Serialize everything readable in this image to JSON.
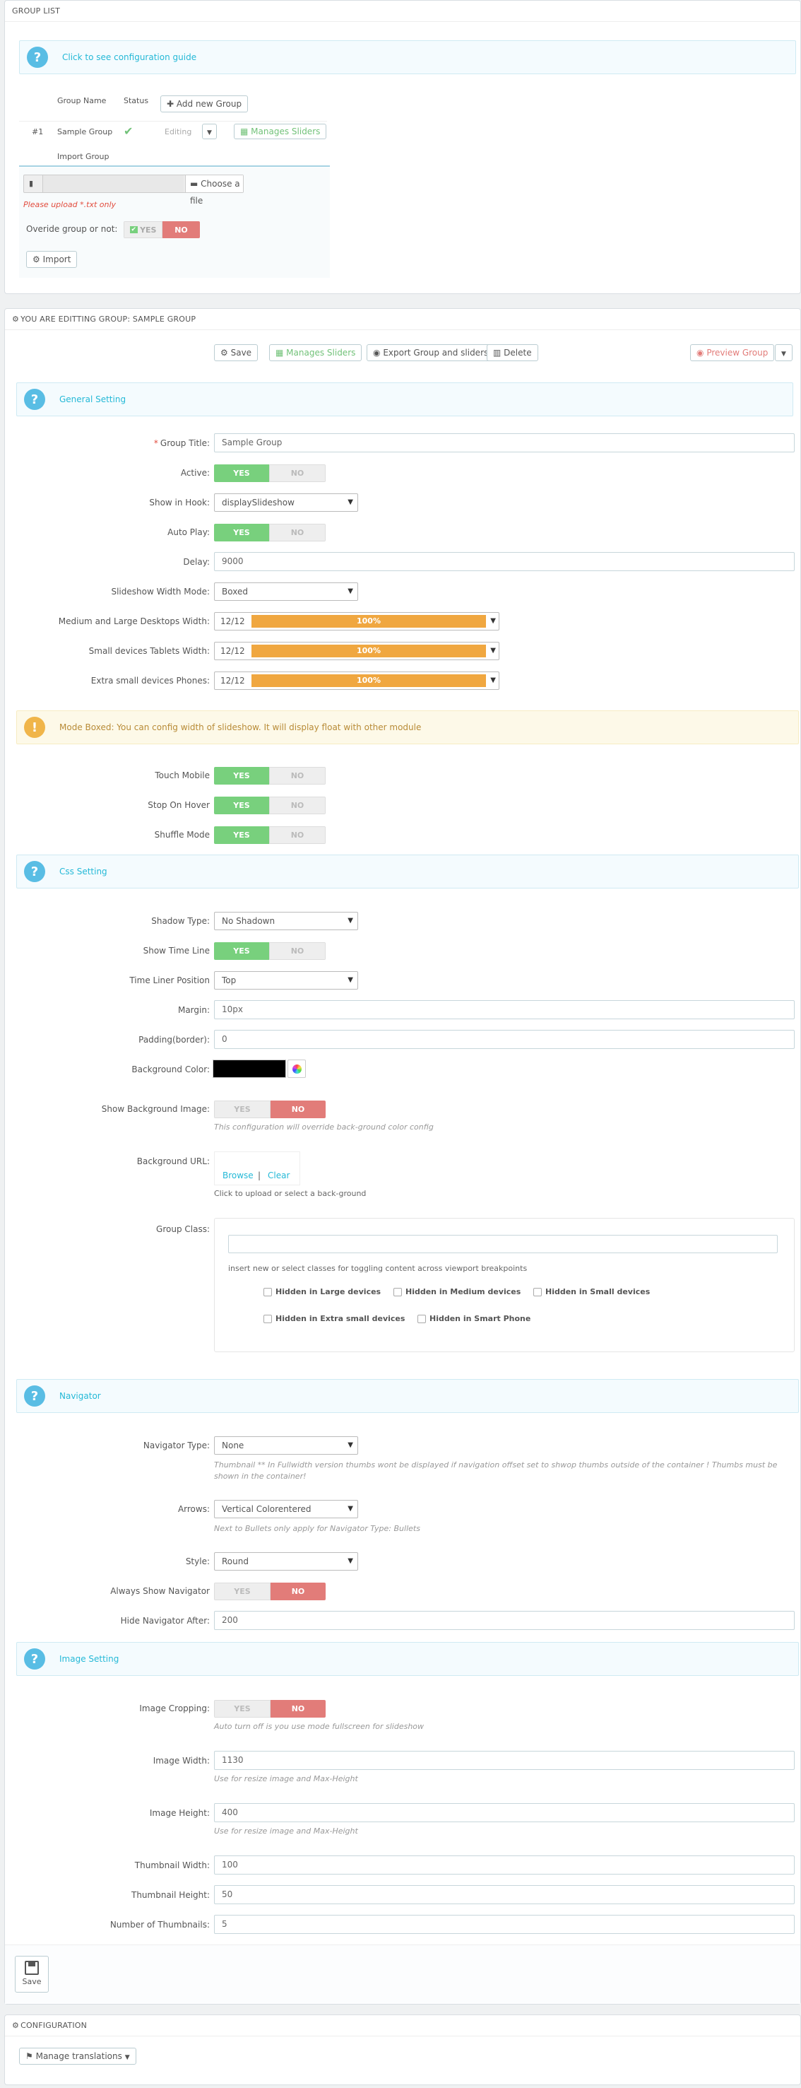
{
  "group_list": {
    "heading": "GROUP LIST",
    "guide": "Click to see configuration guide",
    "col_name": "Group Name",
    "col_status": "Status",
    "add_new": "Add new Group",
    "row": {
      "num": "#1",
      "name": "Sample Group",
      "editing": "Editing",
      "manage": "Manages Sliders"
    },
    "import_title": "Import Group",
    "choose_file": "Choose a file",
    "upload_note": "Please upload *.txt only",
    "override_label": "Overide group or not:",
    "yes": "YES",
    "no": "NO",
    "import_btn": "Import"
  },
  "editing": {
    "heading": "YOU ARE EDITTING GROUP: SAMPLE GROUP",
    "toolbar": {
      "save": "Save",
      "manage": "Manages Sliders",
      "export": "Export Group and sliders",
      "delete": "Delete",
      "preview": "Preview Group"
    },
    "general_setting": "General Setting",
    "group_title_label": "Group Title:",
    "group_title_value": "Sample Group",
    "active_label": "Active:",
    "hook_label": "Show in Hook:",
    "hook_value": "displaySlideshow",
    "autoplay_label": "Auto Play:",
    "delay_label": "Delay:",
    "delay_value": "9000",
    "width_mode_label": "Slideshow Width Mode:",
    "width_mode_value": "Boxed",
    "md_label": "Medium and Large Desktops Width:",
    "sm_label": "Small devices Tablets Width:",
    "xs_label": "Extra small devices Phones:",
    "frac": "12/12",
    "pct": "100%",
    "pct_value": 100,
    "boxed_note": "Mode Boxed: You can config width of slideshow. It will display float with other module",
    "touch_label": "Touch Mobile",
    "hover_label": "Stop On Hover",
    "shuffle_label": "Shuffle Mode",
    "css_setting": "Css Setting",
    "shadow_label": "Shadow Type:",
    "shadow_value": "No Shadown",
    "timeline_label": "Show Time Line",
    "timeline_pos_label": "Time Liner Position",
    "timeline_pos_value": "Top",
    "margin_label": "Margin:",
    "margin_value": "10px",
    "padding_label": "Padding(border):",
    "padding_value": "0",
    "bgcolor_label": "Background Color:",
    "bgcolor_value": "#000000",
    "show_bg_label": "Show Background Image:",
    "show_bg_help": "This configuration will override back-ground color config",
    "bg_url_label": "Background URL:",
    "browse": "Browse",
    "sep": "|",
    "clear": "Clear",
    "bg_url_help": "Click to upload or select a back-ground",
    "group_class_label": "Group Class:",
    "group_class_help": "insert new or select classes for toggling content across viewport breakpoints",
    "hidden_lg": "Hidden in Large devices",
    "hidden_md": "Hidden in Medium devices",
    "hidden_sm": "Hidden in Small devices",
    "hidden_xs": "Hidden in Extra small devices",
    "hidden_sp": "Hidden in Smart Phone",
    "navigator": "Navigator",
    "nav_type_label": "Navigator Type:",
    "nav_type_value": "None",
    "nav_type_help": "Thumbnail ** In Fullwidth version thumbs wont be displayed if navigation offset set to shwop thumbs outside of the container ! Thumbs must be shown in the container!",
    "arrows_label": "Arrows:",
    "arrows_value": "Vertical Colorentered",
    "arrows_help": "Next to Bullets only apply for Navigator Type: Bullets",
    "style_label": "Style:",
    "style_value": "Round",
    "always_nav_label": "Always Show Navigator",
    "hide_nav_label": "Hide Navigator After:",
    "hide_nav_value": "200",
    "image_setting": "Image Setting",
    "crop_label": "Image Cropping:",
    "crop_help": "Auto turn off is you use mode fullscreen for slideshow",
    "img_w_label": "Image Width:",
    "img_w_value": "1130",
    "img_w_help": "Use for resize image and Max-Height",
    "img_h_label": "Image Height:",
    "img_h_value": "400",
    "img_h_help": "Use for resize image and Max-Height",
    "thumb_w_label": "Thumbnail Width:",
    "thumb_w_value": "100",
    "thumb_h_label": "Thumbnail Height:",
    "thumb_h_value": "50",
    "thumb_n_label": "Number of Thumbnails:",
    "thumb_n_value": "5",
    "save_footer": "Save"
  },
  "configuration": {
    "heading": "CONFIGURATION",
    "manage_translations": "Manage translations"
  },
  "colors": {
    "accent": "#25b9d7",
    "yes": "#78d07d",
    "no": "#e27c79",
    "bar": "#f0a740"
  }
}
